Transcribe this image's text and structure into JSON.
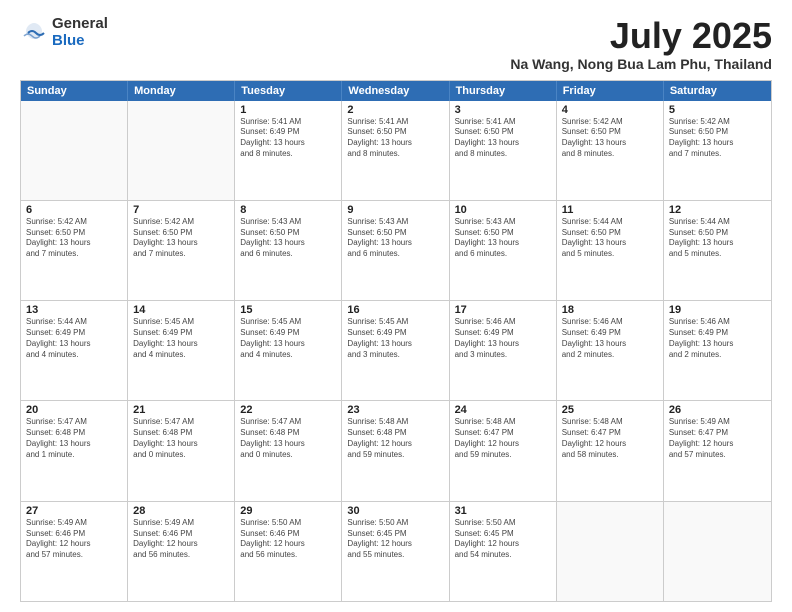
{
  "logo": {
    "general": "General",
    "blue": "Blue"
  },
  "title": "July 2025",
  "subtitle": "Na Wang, Nong Bua Lam Phu, Thailand",
  "header_days": [
    "Sunday",
    "Monday",
    "Tuesday",
    "Wednesday",
    "Thursday",
    "Friday",
    "Saturday"
  ],
  "weeks": [
    [
      {
        "day": "",
        "info": ""
      },
      {
        "day": "",
        "info": ""
      },
      {
        "day": "1",
        "info": "Sunrise: 5:41 AM\nSunset: 6:49 PM\nDaylight: 13 hours\nand 8 minutes."
      },
      {
        "day": "2",
        "info": "Sunrise: 5:41 AM\nSunset: 6:50 PM\nDaylight: 13 hours\nand 8 minutes."
      },
      {
        "day": "3",
        "info": "Sunrise: 5:41 AM\nSunset: 6:50 PM\nDaylight: 13 hours\nand 8 minutes."
      },
      {
        "day": "4",
        "info": "Sunrise: 5:42 AM\nSunset: 6:50 PM\nDaylight: 13 hours\nand 8 minutes."
      },
      {
        "day": "5",
        "info": "Sunrise: 5:42 AM\nSunset: 6:50 PM\nDaylight: 13 hours\nand 7 minutes."
      }
    ],
    [
      {
        "day": "6",
        "info": "Sunrise: 5:42 AM\nSunset: 6:50 PM\nDaylight: 13 hours\nand 7 minutes."
      },
      {
        "day": "7",
        "info": "Sunrise: 5:42 AM\nSunset: 6:50 PM\nDaylight: 13 hours\nand 7 minutes."
      },
      {
        "day": "8",
        "info": "Sunrise: 5:43 AM\nSunset: 6:50 PM\nDaylight: 13 hours\nand 6 minutes."
      },
      {
        "day": "9",
        "info": "Sunrise: 5:43 AM\nSunset: 6:50 PM\nDaylight: 13 hours\nand 6 minutes."
      },
      {
        "day": "10",
        "info": "Sunrise: 5:43 AM\nSunset: 6:50 PM\nDaylight: 13 hours\nand 6 minutes."
      },
      {
        "day": "11",
        "info": "Sunrise: 5:44 AM\nSunset: 6:50 PM\nDaylight: 13 hours\nand 5 minutes."
      },
      {
        "day": "12",
        "info": "Sunrise: 5:44 AM\nSunset: 6:50 PM\nDaylight: 13 hours\nand 5 minutes."
      }
    ],
    [
      {
        "day": "13",
        "info": "Sunrise: 5:44 AM\nSunset: 6:49 PM\nDaylight: 13 hours\nand 4 minutes."
      },
      {
        "day": "14",
        "info": "Sunrise: 5:45 AM\nSunset: 6:49 PM\nDaylight: 13 hours\nand 4 minutes."
      },
      {
        "day": "15",
        "info": "Sunrise: 5:45 AM\nSunset: 6:49 PM\nDaylight: 13 hours\nand 4 minutes."
      },
      {
        "day": "16",
        "info": "Sunrise: 5:45 AM\nSunset: 6:49 PM\nDaylight: 13 hours\nand 3 minutes."
      },
      {
        "day": "17",
        "info": "Sunrise: 5:46 AM\nSunset: 6:49 PM\nDaylight: 13 hours\nand 3 minutes."
      },
      {
        "day": "18",
        "info": "Sunrise: 5:46 AM\nSunset: 6:49 PM\nDaylight: 13 hours\nand 2 minutes."
      },
      {
        "day": "19",
        "info": "Sunrise: 5:46 AM\nSunset: 6:49 PM\nDaylight: 13 hours\nand 2 minutes."
      }
    ],
    [
      {
        "day": "20",
        "info": "Sunrise: 5:47 AM\nSunset: 6:48 PM\nDaylight: 13 hours\nand 1 minute."
      },
      {
        "day": "21",
        "info": "Sunrise: 5:47 AM\nSunset: 6:48 PM\nDaylight: 13 hours\nand 0 minutes."
      },
      {
        "day": "22",
        "info": "Sunrise: 5:47 AM\nSunset: 6:48 PM\nDaylight: 13 hours\nand 0 minutes."
      },
      {
        "day": "23",
        "info": "Sunrise: 5:48 AM\nSunset: 6:48 PM\nDaylight: 12 hours\nand 59 minutes."
      },
      {
        "day": "24",
        "info": "Sunrise: 5:48 AM\nSunset: 6:47 PM\nDaylight: 12 hours\nand 59 minutes."
      },
      {
        "day": "25",
        "info": "Sunrise: 5:48 AM\nSunset: 6:47 PM\nDaylight: 12 hours\nand 58 minutes."
      },
      {
        "day": "26",
        "info": "Sunrise: 5:49 AM\nSunset: 6:47 PM\nDaylight: 12 hours\nand 57 minutes."
      }
    ],
    [
      {
        "day": "27",
        "info": "Sunrise: 5:49 AM\nSunset: 6:46 PM\nDaylight: 12 hours\nand 57 minutes."
      },
      {
        "day": "28",
        "info": "Sunrise: 5:49 AM\nSunset: 6:46 PM\nDaylight: 12 hours\nand 56 minutes."
      },
      {
        "day": "29",
        "info": "Sunrise: 5:50 AM\nSunset: 6:46 PM\nDaylight: 12 hours\nand 56 minutes."
      },
      {
        "day": "30",
        "info": "Sunrise: 5:50 AM\nSunset: 6:45 PM\nDaylight: 12 hours\nand 55 minutes."
      },
      {
        "day": "31",
        "info": "Sunrise: 5:50 AM\nSunset: 6:45 PM\nDaylight: 12 hours\nand 54 minutes."
      },
      {
        "day": "",
        "info": ""
      },
      {
        "day": "",
        "info": ""
      }
    ]
  ]
}
